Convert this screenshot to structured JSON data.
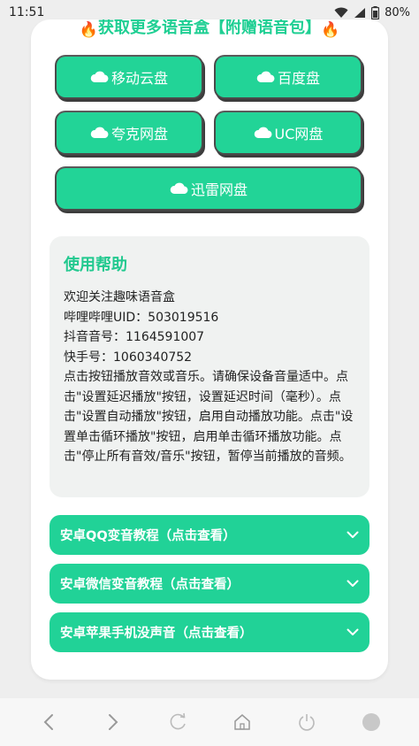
{
  "status": {
    "time": "11:51",
    "battery": "80%"
  },
  "promo": {
    "title": "获取更多语音盒【附赠语音包】"
  },
  "buttons": [
    {
      "label": "移动云盘"
    },
    {
      "label": "百度盘"
    },
    {
      "label": "夸克网盘"
    },
    {
      "label": "UC网盘"
    },
    {
      "label": "迅雷网盘"
    }
  ],
  "help": {
    "title": "使用帮助",
    "lines": [
      "欢迎关注趣味语音盒",
      "哔哩哔哩UID：503019516",
      "抖音音号：1164591007",
      "快手号：1060340752",
      "点击按钮播放音效或音乐。请确保设备音量适中。点击\"设置延迟播放\"按钮，设置延迟时间（毫秒）。点击\"设置自动播放\"按钮，启用自动播放功能。点击\"设置单击循环播放\"按钮，启用单击循环播放功能。点击\"停止所有音效/音乐\"按钮，暂停当前播放的音频。"
    ]
  },
  "accordions": [
    {
      "label": "安卓QQ变音教程（点击查看）"
    },
    {
      "label": "安卓微信变音教程（点击查看）"
    },
    {
      "label": "安卓苹果手机没声音（点击查看）"
    }
  ],
  "colors": {
    "accent": "#22d497",
    "card": "#ffffff",
    "help_bg": "#f0f2f1"
  },
  "icons": [
    "cloud-icon",
    "fire-icon",
    "chevron-down-icon",
    "back-icon",
    "forward-icon",
    "refresh-icon",
    "home-icon",
    "power-icon",
    "record-icon"
  ]
}
